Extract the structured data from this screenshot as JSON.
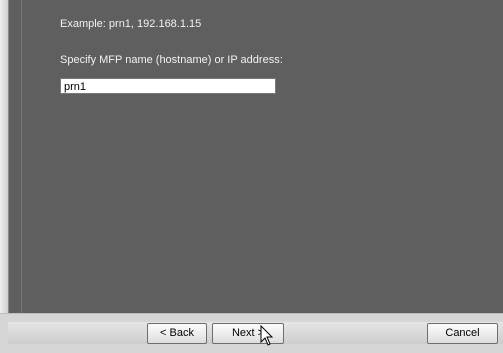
{
  "dialog": {
    "example_text": "Example: prn1, 192.168.1.15",
    "instruction_text": "Specify MFP name (hostname) or IP address:",
    "host_value": "prn1"
  },
  "buttons": {
    "back_label": "< Back",
    "next_label": "Next >",
    "cancel_label": "Cancel"
  },
  "icons": {
    "cursor": "mouse-pointer-icon"
  },
  "colors": {
    "panel": "#5f5f5f",
    "text": "#f2f2f2",
    "button_bar": "#d6d6d6"
  }
}
